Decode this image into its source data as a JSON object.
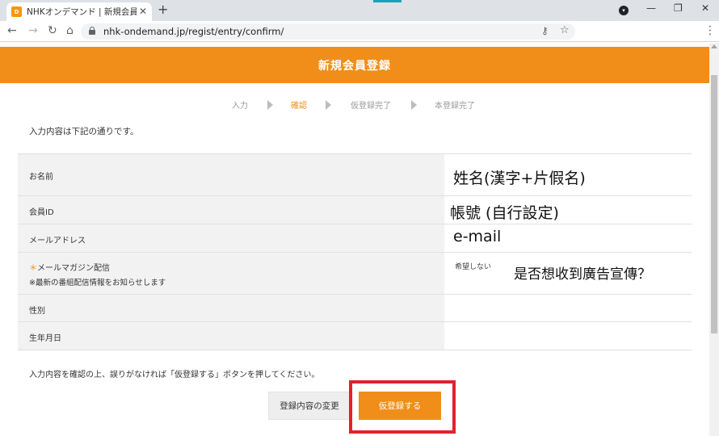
{
  "browser": {
    "tab_title": "NHKオンデマンド | 新規会員登録",
    "favicon_text": "D",
    "url": "nhk-ondemand.jp/regist/entry/confirm/",
    "new_tab": "+",
    "minimize": "—",
    "maximize": "❐",
    "close": "✕"
  },
  "header": {
    "title": "新規会員登録"
  },
  "steps": [
    {
      "label": "入力",
      "active": false
    },
    {
      "label": "確認",
      "active": true
    },
    {
      "label": "仮登録完了",
      "active": false
    },
    {
      "label": "本登録完了",
      "active": false
    }
  ],
  "intro": "入力内容は下記の通りです。",
  "fields": {
    "name": {
      "label": "お名前",
      "annotation": "姓名(漢字+片假名)"
    },
    "member_id": {
      "label": "会員ID",
      "annotation": "帳號 (自行設定)"
    },
    "email": {
      "label": "メールアドレス",
      "annotation": "e-mail"
    },
    "magazine": {
      "required_mark": "＊",
      "label": "メールマガジン配信",
      "sublabel": "※最新の番組配信情報をお知らせします",
      "value": "希望しない",
      "annotation": "是否想收到廣告宣傳？"
    },
    "gender": {
      "label": "性別"
    },
    "birthday": {
      "label": "生年月日"
    }
  },
  "note": "入力内容を確認の上、誤りがなければ「仮登録する」ボタンを押してください。",
  "buttons": {
    "change": "登録内容の変更",
    "submit": "仮登録する"
  },
  "colors": {
    "accent": "#f08e19",
    "highlight": "#e0222c"
  }
}
